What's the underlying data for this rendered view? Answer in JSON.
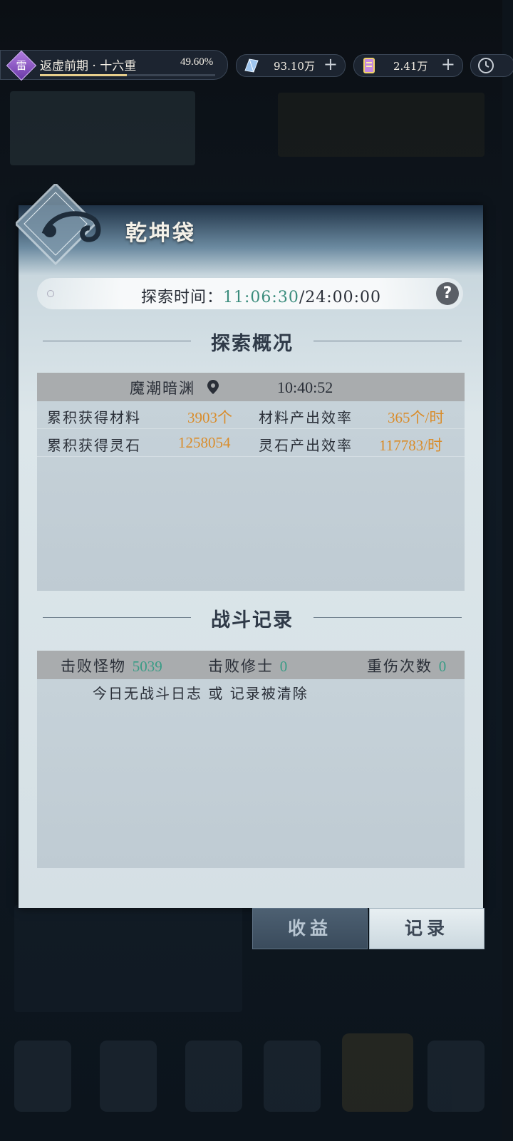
{
  "top_bar": {
    "realm_badge": "雷",
    "realm_title": "返虚前期 · 十六重",
    "realm_progress_text": "49.60%",
    "realm_progress": 0.496,
    "resource1_value": "93.10万",
    "resource2_value": "2.41万",
    "plus": "+"
  },
  "panel": {
    "title": "乾坤袋",
    "explore_time_label": "探索时间：",
    "explore_time_current": "11:06:30",
    "explore_time_total": "/24:00:00",
    "help": "?"
  },
  "overview": {
    "heading": "探索概况",
    "location": "魔潮暗渊",
    "location_time": "10:40:52",
    "rows": [
      {
        "label1": "累积获得材料",
        "value1": "3903个",
        "label2": "材料产出效率",
        "value2": "365个/时"
      },
      {
        "label1": "累积获得灵石",
        "value1": "1258054",
        "label2": "灵石产出效率",
        "value2": "117783/时"
      }
    ]
  },
  "battle": {
    "heading": "战斗记录",
    "defeat_monsters_label": "击败怪物",
    "defeat_monsters_value": "5039",
    "defeat_cultivators_label": "击败修士",
    "defeat_cultivators_value": "0",
    "heavy_injury_label": "重伤次数",
    "heavy_injury_value": "0",
    "empty_message": "今日无战斗日志 或 记录被清除"
  },
  "tabs": {
    "income": "收益",
    "record": "记录"
  },
  "colors": {
    "accent_orange": "#d98c2a",
    "accent_green": "#3a9c86",
    "realm_purple": "#8a52c8"
  }
}
